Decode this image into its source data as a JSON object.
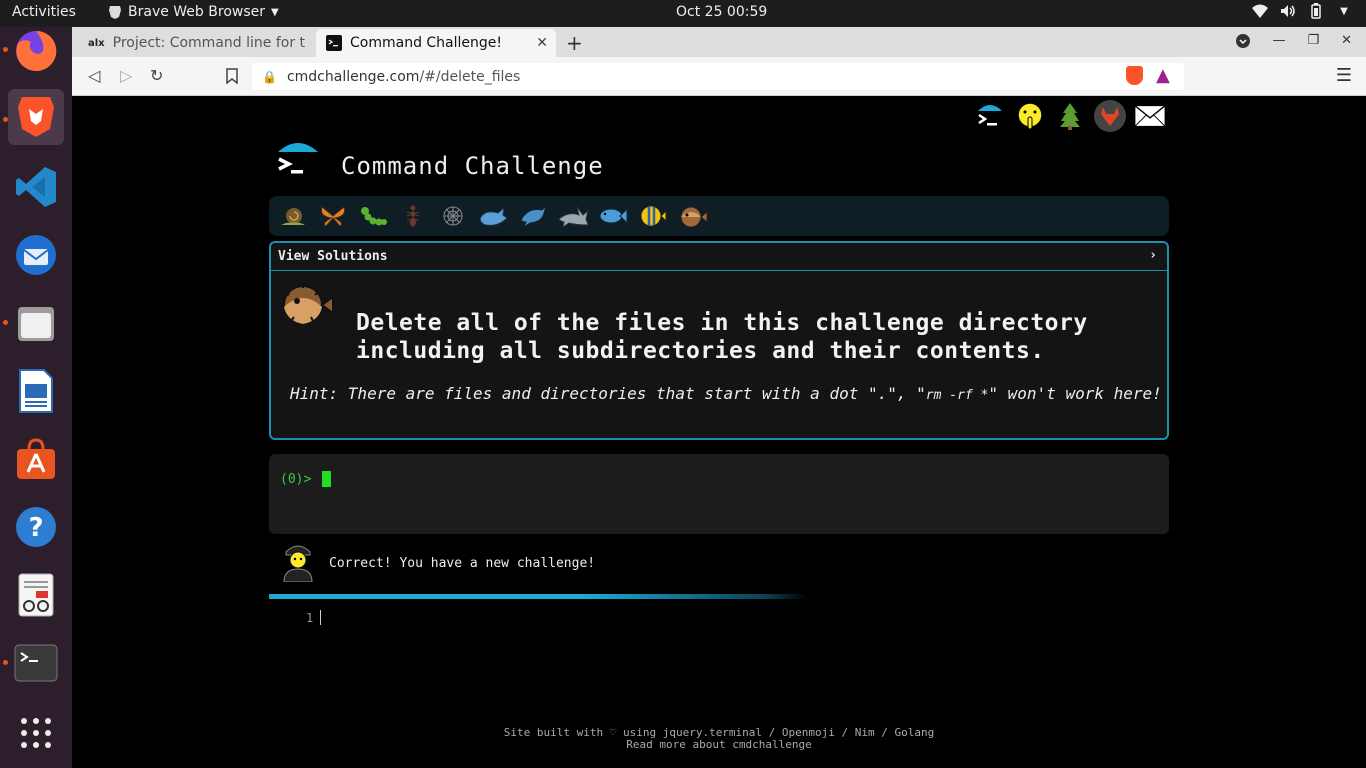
{
  "topbar": {
    "activities": "Activities",
    "app_name": "Brave Web Browser",
    "clock": "Oct 25  00:59"
  },
  "browser": {
    "tabs": [
      {
        "label": "Project: Command line for the",
        "favicon": "alx-icon"
      },
      {
        "label": "Command Challenge!",
        "favicon": "terminal-icon"
      }
    ],
    "url_host": "cmdchallenge.com",
    "url_path": "/#/delete_files"
  },
  "page": {
    "title": "Command Challenge",
    "view_solutions": "View Solutions",
    "chevron": "›",
    "challenge_line1": "Delete all of the files in this challenge directory",
    "challenge_line2": "including all subdirectories and their contents.",
    "hint_pre": "Hint: There are files and directories that start with a dot \".\", \"",
    "hint_code": "rm -rf *",
    "hint_post": "\" won't work here!",
    "prompt": "(0)>",
    "feedback": "Correct! You have a new challenge!",
    "progress_fraction": 0.6,
    "editor_line_number": "1",
    "footer_line1": "Site built with ♡ using jquery.terminal / Openmoji / Nim / Golang",
    "footer_line2": "Read more about cmdchallenge"
  },
  "levels": [
    "snail",
    "butterfly",
    "caterpillar",
    "ant",
    "spider-web",
    "whale",
    "dolphin",
    "shark",
    "fish",
    "tropical-fish",
    "pufferfish"
  ],
  "colors": {
    "accent": "#1ea8d6",
    "prompt_green": "#3cc93c",
    "dock_bg": "#2c1f2b",
    "ubuntu_orange": "#e95420"
  }
}
